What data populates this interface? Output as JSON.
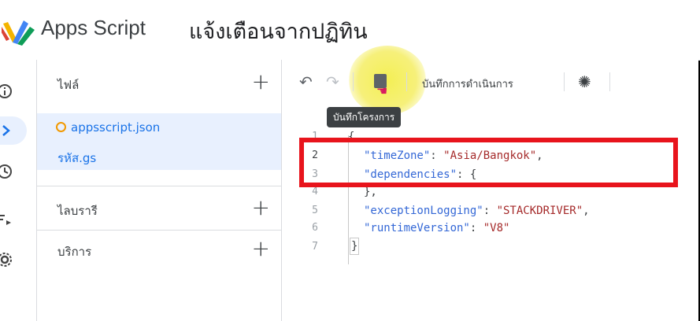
{
  "header": {
    "app_name": "Apps Script",
    "project_title": "แจ้งเตือนจากปฏิทิน"
  },
  "sidebar": {
    "files_label": "ไฟล์",
    "files": [
      {
        "name": "appsscript.json"
      },
      {
        "name": "รหัส.gs"
      }
    ],
    "libraries_label": "ไลบรารี",
    "services_label": "บริการ"
  },
  "toolbar": {
    "run_log_label": "บันทึกการดำเนินการ",
    "save_tooltip": "บันทึกโครงการ"
  },
  "code": {
    "lines": [
      {
        "num": "1",
        "text": "{"
      },
      {
        "num": "2",
        "key": "\"timeZone\"",
        "sep": ": ",
        "value": "\"Asia/Bangkok\"",
        "end": ","
      },
      {
        "num": "3",
        "key": "\"dependencies\"",
        "sep": ": ",
        "end": "{"
      },
      {
        "num": "4",
        "text": "},"
      },
      {
        "num": "5",
        "key": "\"exceptionLogging\"",
        "sep": ": ",
        "value": "\"STACKDRIVER\"",
        "end": ","
      },
      {
        "num": "6",
        "key": "\"runtimeVersion\"",
        "sep": ": ",
        "value": "\"V8\"",
        "end": ""
      },
      {
        "num": "7",
        "text": "}"
      }
    ]
  },
  "colors": {
    "accent": "#1a73e8",
    "highlight_box": "#e8141c",
    "cursor_highlight": "#f4ef55"
  }
}
